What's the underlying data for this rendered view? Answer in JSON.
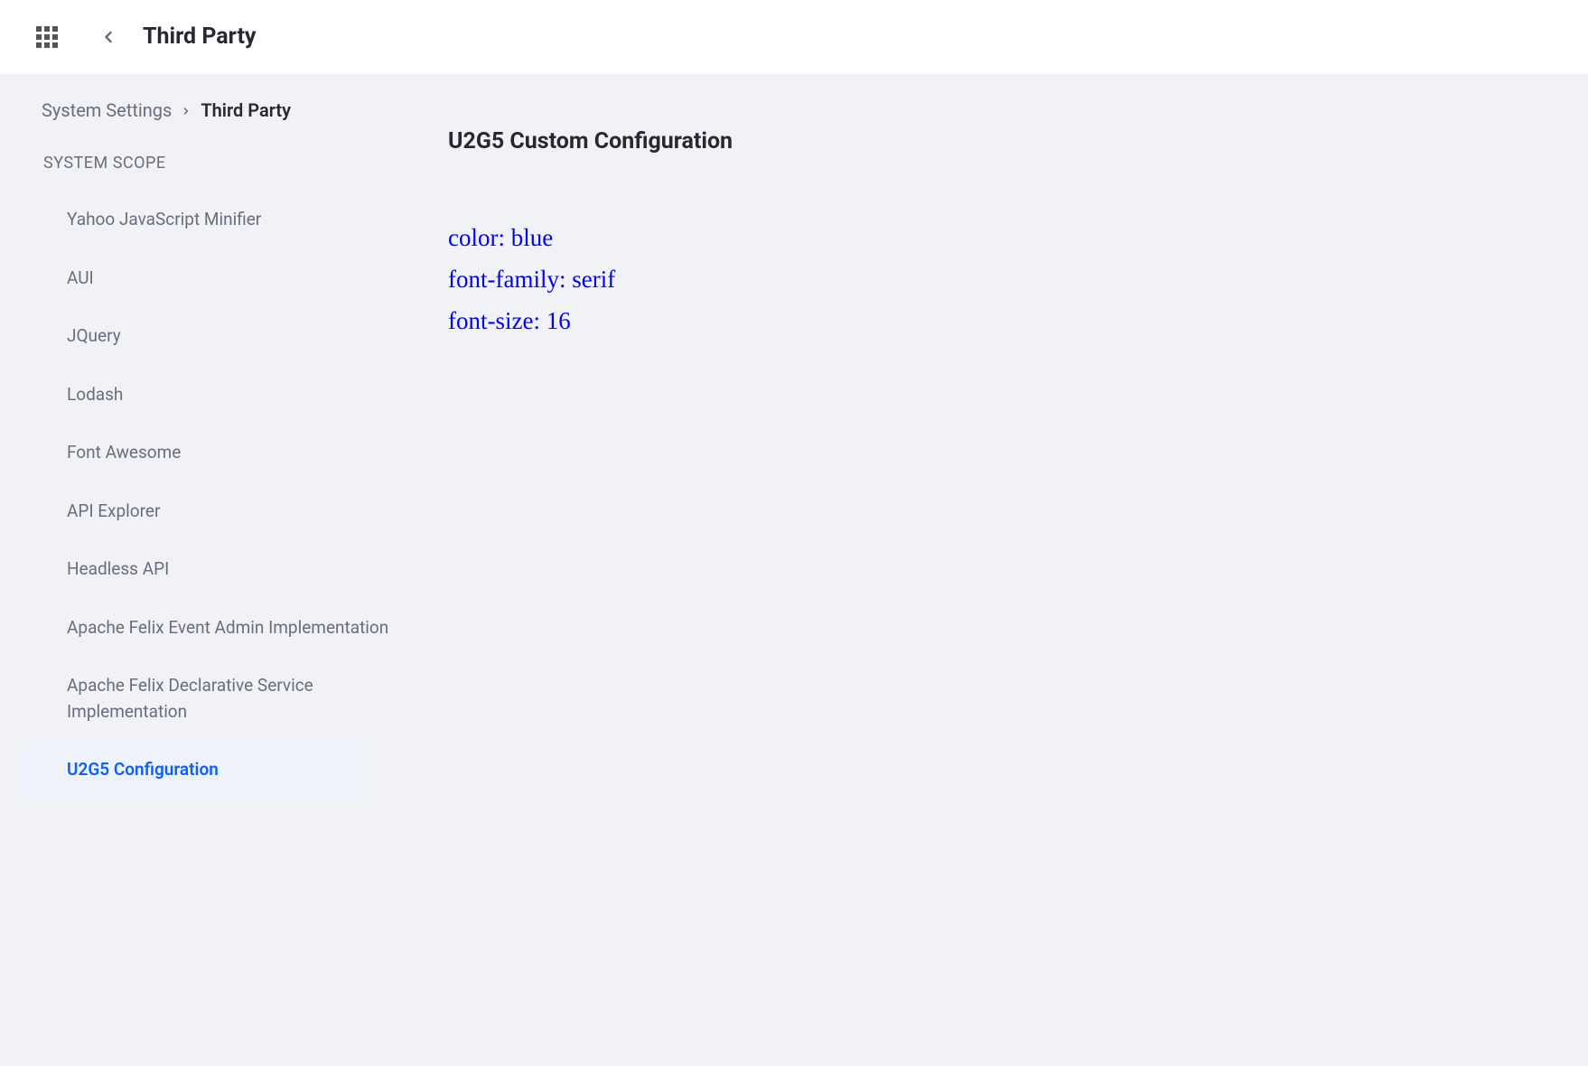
{
  "header": {
    "title": "Third Party"
  },
  "breadcrumb": {
    "parent": "System Settings",
    "current": "Third Party"
  },
  "sidebar": {
    "scope_label": "SYSTEM SCOPE",
    "items": [
      {
        "label": "Yahoo JavaScript Minifier",
        "active": false
      },
      {
        "label": "AUI",
        "active": false
      },
      {
        "label": "JQuery",
        "active": false
      },
      {
        "label": "Lodash",
        "active": false
      },
      {
        "label": "Font Awesome",
        "active": false
      },
      {
        "label": "API Explorer",
        "active": false
      },
      {
        "label": "Headless API",
        "active": false
      },
      {
        "label": "Apache Felix Event Admin Implementation",
        "active": false
      },
      {
        "label": "Apache Felix Declarative Service Implementation",
        "active": false
      },
      {
        "label": "U2G5 Configuration",
        "active": true
      }
    ]
  },
  "content": {
    "title": "U2G5 Custom Configuration",
    "config_lines": [
      "color: blue",
      "font-family: serif",
      "font-size: 16"
    ]
  }
}
